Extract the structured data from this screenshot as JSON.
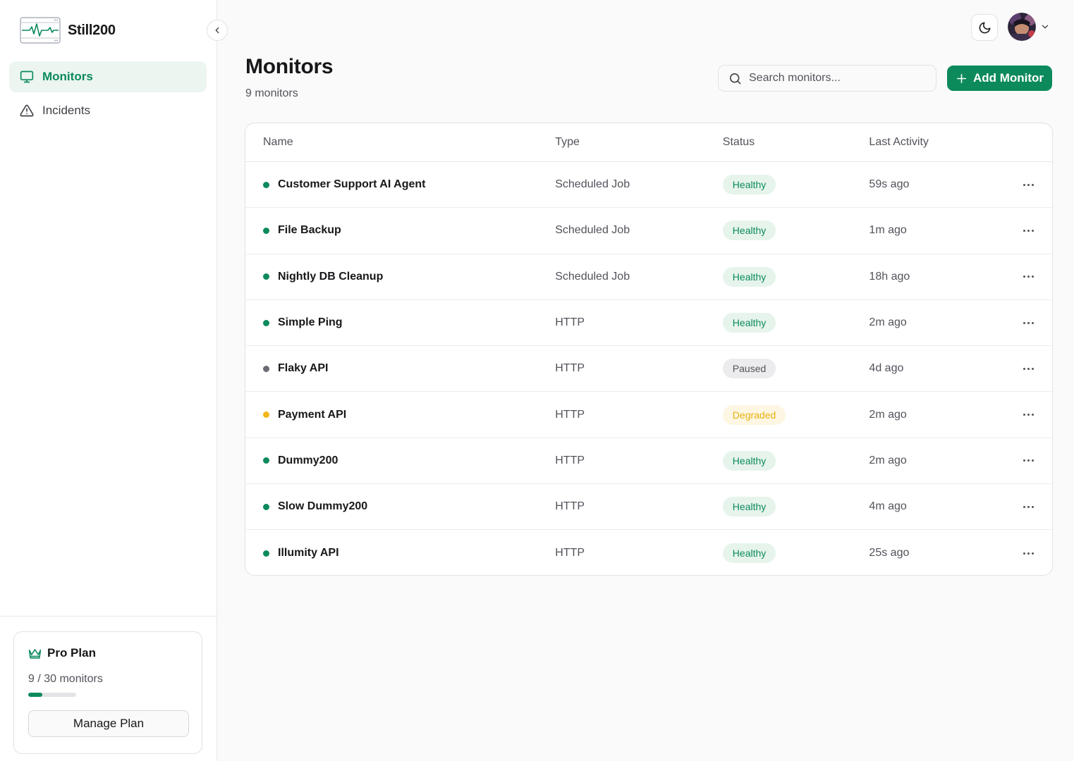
{
  "app": {
    "name": "Still200"
  },
  "sidebar": {
    "items": [
      {
        "label": "Monitors",
        "active": true
      },
      {
        "label": "Incidents",
        "active": false
      }
    ],
    "plan": {
      "title": "Pro Plan",
      "used": 9,
      "limit": 30,
      "usage_text": "9 / 30 monitors",
      "button_label": "Manage Plan"
    }
  },
  "header": {
    "title": "Monitors",
    "subtitle": "9 monitors",
    "search_placeholder": "Search monitors...",
    "add_label": "Add Monitor"
  },
  "table": {
    "columns": [
      "Name",
      "Type",
      "Status",
      "Last Activity"
    ],
    "rows": [
      {
        "name": "Customer Support AI Agent",
        "type": "Scheduled Job",
        "status": "Healthy",
        "last": "59s ago"
      },
      {
        "name": "File Backup",
        "type": "Scheduled Job",
        "status": "Healthy",
        "last": "1m ago"
      },
      {
        "name": "Nightly DB Cleanup",
        "type": "Scheduled Job",
        "status": "Healthy",
        "last": "18h ago"
      },
      {
        "name": "Simple Ping",
        "type": "HTTP",
        "status": "Healthy",
        "last": "2m ago"
      },
      {
        "name": "Flaky API",
        "type": "HTTP",
        "status": "Paused",
        "last": "4d ago"
      },
      {
        "name": "Payment API",
        "type": "HTTP",
        "status": "Degraded",
        "last": "2m ago"
      },
      {
        "name": "Dummy200",
        "type": "HTTP",
        "status": "Healthy",
        "last": "2m ago"
      },
      {
        "name": "Slow Dummy200",
        "type": "HTTP",
        "status": "Healthy",
        "last": "4m ago"
      },
      {
        "name": "Illumity API",
        "type": "HTTP",
        "status": "Healthy",
        "last": "25s ago"
      }
    ]
  },
  "colors": {
    "accent": "#0c8a5c",
    "healthy_bg": "#e6f4ec",
    "healthy_fg": "#0c8a5c",
    "paused_bg": "#ececee",
    "paused_fg": "#52525b",
    "paused_dot": "#6b6b73",
    "degraded_bg": "#fdf6e3",
    "degraded_fg": "#e8b10f",
    "degraded_dot": "#f2b619"
  },
  "icons": {
    "logo": "heartbeat-logo-icon",
    "nav_monitors": "monitor-icon",
    "nav_incidents": "warning-triangle-icon",
    "plan": "crown-icon",
    "search": "search-icon",
    "add": "plus-icon",
    "theme": "moon-icon",
    "collapse": "chevron-left-icon",
    "account": "chevron-down-icon",
    "row_menu": "more-horizontal-icon"
  }
}
